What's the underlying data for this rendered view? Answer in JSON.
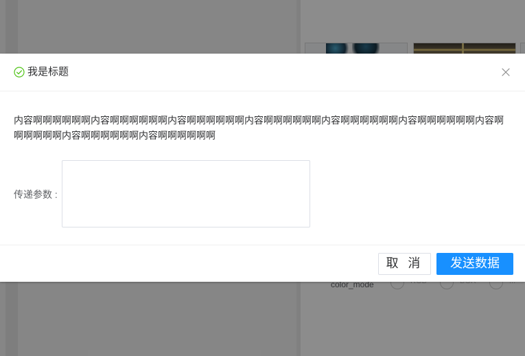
{
  "background": {
    "color_mode_label": "color_mode",
    "radio_options": [
      "RGB",
      "BGR",
      "..."
    ]
  },
  "dialog": {
    "title": "我是标题",
    "content": "内容啊啊啊啊啊啊内容啊啊啊啊啊啊内容啊啊啊啊啊啊内容啊啊啊啊啊啊内容啊啊啊啊啊啊内容啊啊啊啊啊啊内容啊啊啊啊啊啊内容啊啊啊啊啊啊内容啊啊啊啊啊啊",
    "param_label": "传递参数 :",
    "param_value": "",
    "cancel_label": "取 消",
    "send_label": "发送数据",
    "success_icon": "check-circle-icon",
    "close_icon": "close-icon",
    "accent_color": "#1890ff",
    "success_color": "#52c41a"
  }
}
